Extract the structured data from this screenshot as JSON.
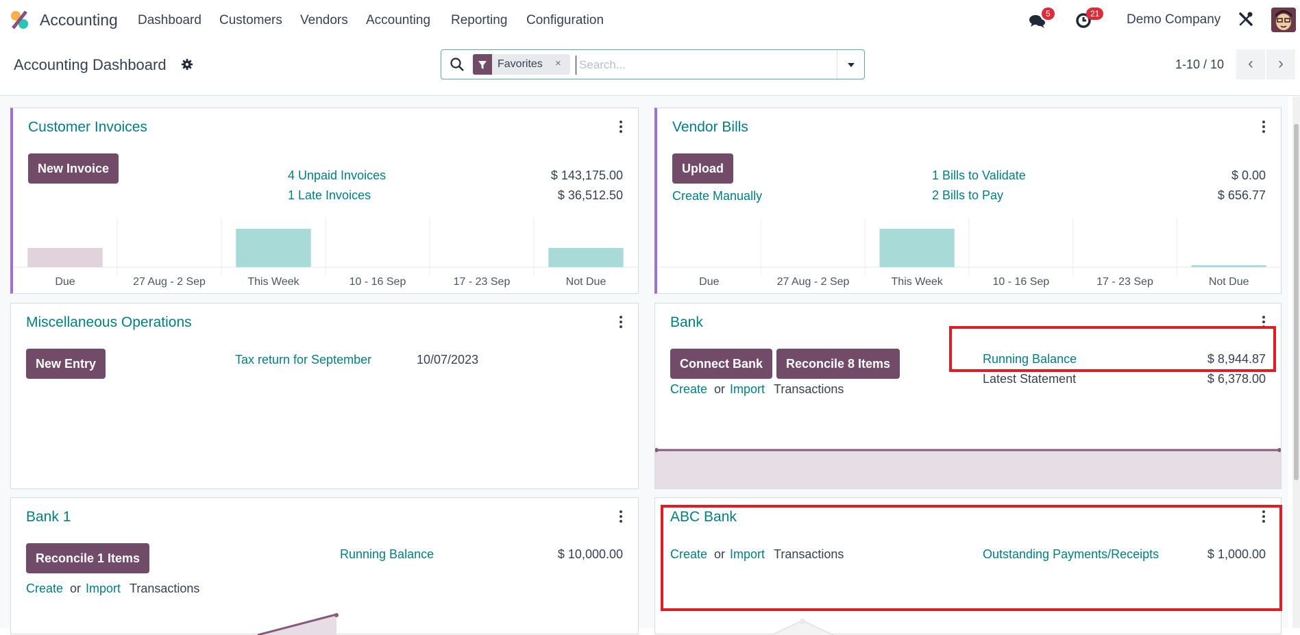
{
  "navbar": {
    "app_name": "Accounting",
    "menu": [
      "Dashboard",
      "Customers",
      "Vendors",
      "Accounting",
      "Reporting",
      "Configuration"
    ],
    "messages_count": "5",
    "activities_count": "21",
    "company": "Demo Company",
    "icons": {
      "messages": "chat-bubbles-icon",
      "activities": "clock-icon",
      "debug": "tools-icon"
    }
  },
  "control_panel": {
    "title": "Accounting Dashboard",
    "search": {
      "facet_label": "Favorites",
      "placeholder": "Search..."
    },
    "pager": "1-10 / 10",
    "prev_label": "‹",
    "next_label": "›"
  },
  "colors": {
    "primary": "#714b67",
    "link": "#017e84",
    "accent": "#9b6fe0",
    "bar_past": "#e0d3dc",
    "bar_future": "#a8dad7",
    "highlight": "#e31b23"
  },
  "cards": {
    "customer_invoices": {
      "title": "Customer Invoices",
      "button": "New Invoice",
      "stats": [
        {
          "label": "4 Unpaid Invoices",
          "amount": "$ 143,175.00"
        },
        {
          "label": "1 Late Invoices",
          "amount": "$ 36,512.50"
        }
      ]
    },
    "vendor_bills": {
      "title": "Vendor Bills",
      "button": "Upload",
      "create_manually": "Create Manually",
      "stats": [
        {
          "label": "1 Bills to Validate",
          "amount": "$ 0.00"
        },
        {
          "label": "2 Bills to Pay",
          "amount": "$ 656.77"
        }
      ]
    },
    "misc": {
      "title": "Miscellaneous Operations",
      "button": "New Entry",
      "entry_label": "Tax return for September",
      "entry_date": "10/07/2023"
    },
    "bank": {
      "title": "Bank",
      "button_connect": "Connect Bank",
      "button_reconcile": "Reconcile 8 Items",
      "create": "Create",
      "or": "or",
      "import": "Import",
      "transactions": "Transactions",
      "running_balance_label": "Running Balance",
      "running_balance": "$ 8,944.87",
      "latest_statement_label": "Latest Statement",
      "latest_statement": "$ 6,378.00"
    },
    "bank1": {
      "title": "Bank 1",
      "button_reconcile": "Reconcile 1 Items",
      "create": "Create",
      "or": "or",
      "import": "Import",
      "transactions": "Transactions",
      "running_balance_label": "Running Balance",
      "running_balance": "$ 10,000.00"
    },
    "abc_bank": {
      "title": "ABC Bank",
      "create": "Create",
      "or": "or",
      "import": "Import",
      "transactions": "Transactions",
      "outstanding_label": "Outstanding Payments/Receipts",
      "outstanding": "$ 1,000.00"
    }
  },
  "chart_data": [
    {
      "type": "bar",
      "title": "Customer Invoices",
      "categories": [
        "Due",
        "27 Aug - 2 Sep",
        "This Week",
        "10 - 16 Sep",
        "17 - 23 Sep",
        "Not Due"
      ],
      "values": [
        0.5,
        0,
        1.0,
        0,
        0,
        0.5
      ],
      "value_units": "relative",
      "bar_kind": [
        "past",
        "past",
        "future",
        "future",
        "future",
        "future"
      ]
    },
    {
      "type": "bar",
      "title": "Vendor Bills",
      "categories": [
        "Due",
        "27 Aug - 2 Sep",
        "This Week",
        "10 - 16 Sep",
        "17 - 23 Sep",
        "Not Due"
      ],
      "values": [
        0,
        0,
        1.0,
        0,
        0,
        0.05
      ],
      "value_units": "relative",
      "bar_kind": [
        "past",
        "past",
        "future",
        "future",
        "future",
        "future"
      ]
    },
    {
      "type": "area",
      "title": "Bank",
      "series": [
        {
          "name": "balance",
          "values": [
            0.5,
            0.5
          ]
        }
      ]
    },
    {
      "type": "area",
      "title": "Bank 1",
      "series": [
        {
          "name": "balance",
          "values": [
            0.1,
            0.4
          ]
        }
      ]
    }
  ]
}
